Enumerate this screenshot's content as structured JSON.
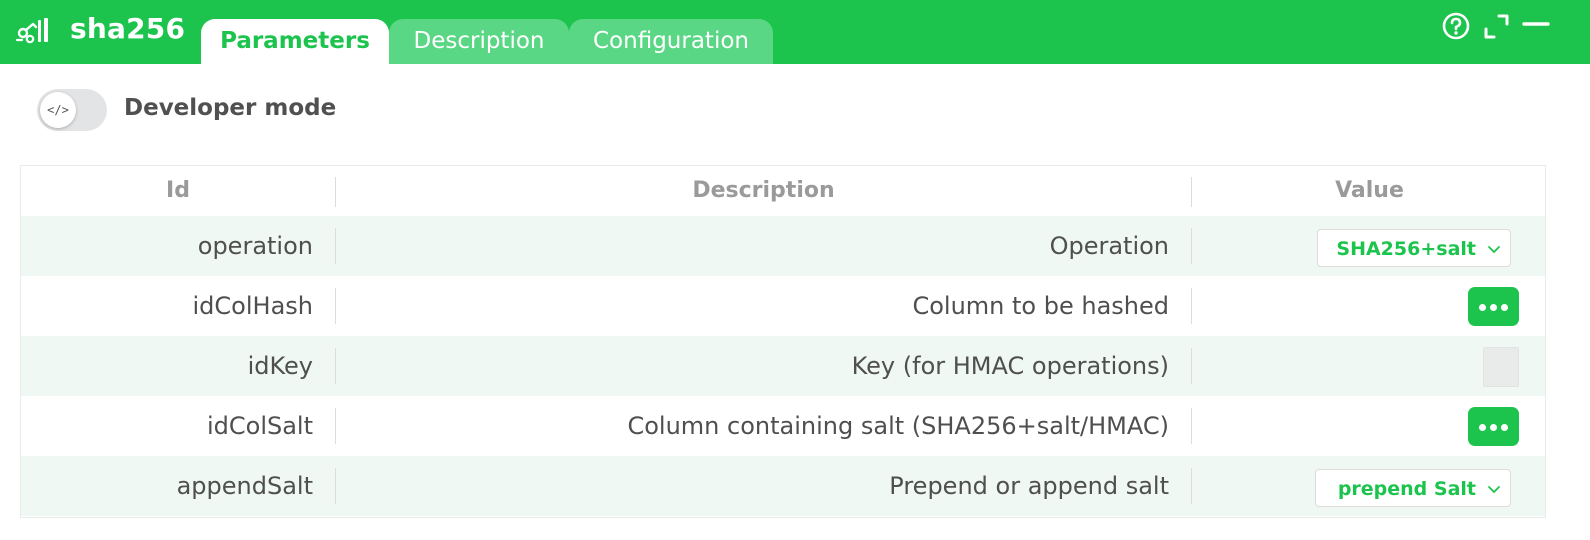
{
  "app": {
    "title": "sha256",
    "logo_icon": "processor-logo-icon",
    "accent": "#1cc44e"
  },
  "tabs": [
    {
      "label": "Parameters",
      "active": true
    },
    {
      "label": "Description",
      "active": false
    },
    {
      "label": "Configuration",
      "active": false
    }
  ],
  "header_icons": [
    "help-icon",
    "expand-icon",
    "minimize-icon"
  ],
  "developer_mode": {
    "label": "Developer mode",
    "knob_text": "</>",
    "enabled": false
  },
  "table": {
    "columns": [
      "Id",
      "Description",
      "Value"
    ],
    "rows": [
      {
        "id": "operation",
        "description": "Operation",
        "value_type": "select",
        "value": "SHA256+salt"
      },
      {
        "id": "idColHash",
        "description": "Column to be hashed",
        "value_type": "button",
        "value_icon": "more-icon"
      },
      {
        "id": "idKey",
        "description": "Key (for HMAC operations)",
        "value_type": "input",
        "value": ""
      },
      {
        "id": "idColSalt",
        "description": "Column containing salt (SHA256+salt/HMAC)",
        "value_type": "button",
        "value_icon": "more-icon"
      },
      {
        "id": "appendSalt",
        "description": "Prepend or append salt",
        "value_type": "select",
        "value": "prepend Salt"
      }
    ]
  }
}
